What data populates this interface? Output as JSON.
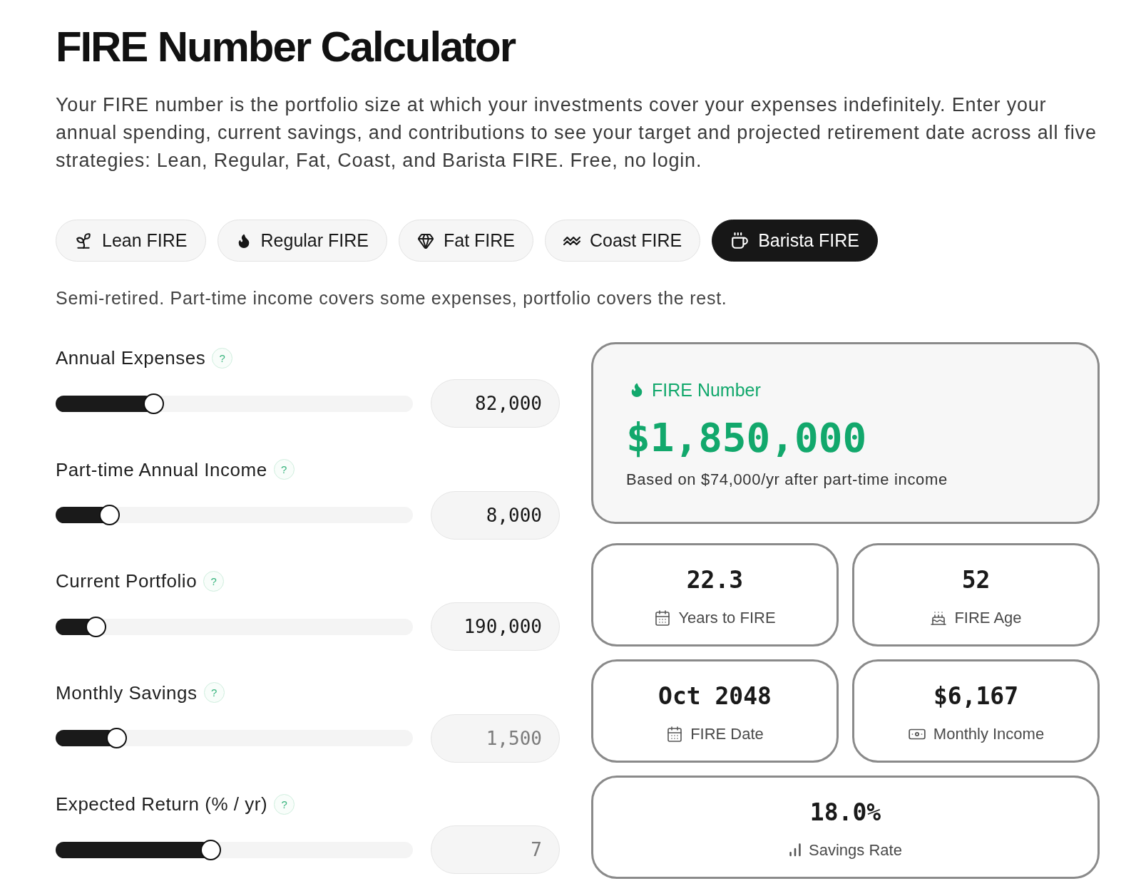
{
  "title": "FIRE Number Calculator",
  "intro": "Your FIRE number is the portfolio size at which your investments cover your expenses indefinitely. Enter your annual spending, current savings, and contributions to see your target and projected retirement date across all five strategies: Lean, Regular, Fat, Coast, and Barista FIRE. Free, no login.",
  "strategies": [
    {
      "label": "Lean FIRE",
      "selected": false
    },
    {
      "label": "Regular FIRE",
      "selected": false
    },
    {
      "label": "Fat FIRE",
      "selected": false
    },
    {
      "label": "Coast FIRE",
      "selected": false
    },
    {
      "label": "Barista FIRE",
      "selected": true
    }
  ],
  "strategy_description": "Semi-retired. Part-time income covers some expenses, portfolio covers the rest.",
  "inputs": [
    {
      "label": "Annual Expenses",
      "help": "?",
      "level": 0.26,
      "value": "82,000"
    },
    {
      "label": "Part-time Annual Income",
      "help": "?",
      "level": 0.13,
      "value": "8,000"
    },
    {
      "label": "Current Portfolio",
      "help": "?",
      "level": 0.09,
      "value": "190,000"
    },
    {
      "label": "Monthly Savings",
      "help": "?",
      "level": 0.15,
      "placeholder": "1,500"
    },
    {
      "label": "Expected Return (% / yr)",
      "help": "?",
      "level": 0.43,
      "placeholder": "7"
    }
  ],
  "fire_number": {
    "label": "FIRE Number",
    "value": "$1,850,000",
    "note": "Based on $74,000/yr after part-time income"
  },
  "stats": [
    {
      "value": "22.3",
      "label": "Years to FIRE"
    },
    {
      "value": "52",
      "label": "FIRE Age"
    },
    {
      "value": "Oct 2048",
      "label": "FIRE Date"
    },
    {
      "value": "$6,167",
      "label": "Monthly Income"
    },
    {
      "value": "18.0%",
      "label": "Savings Rate"
    }
  ]
}
